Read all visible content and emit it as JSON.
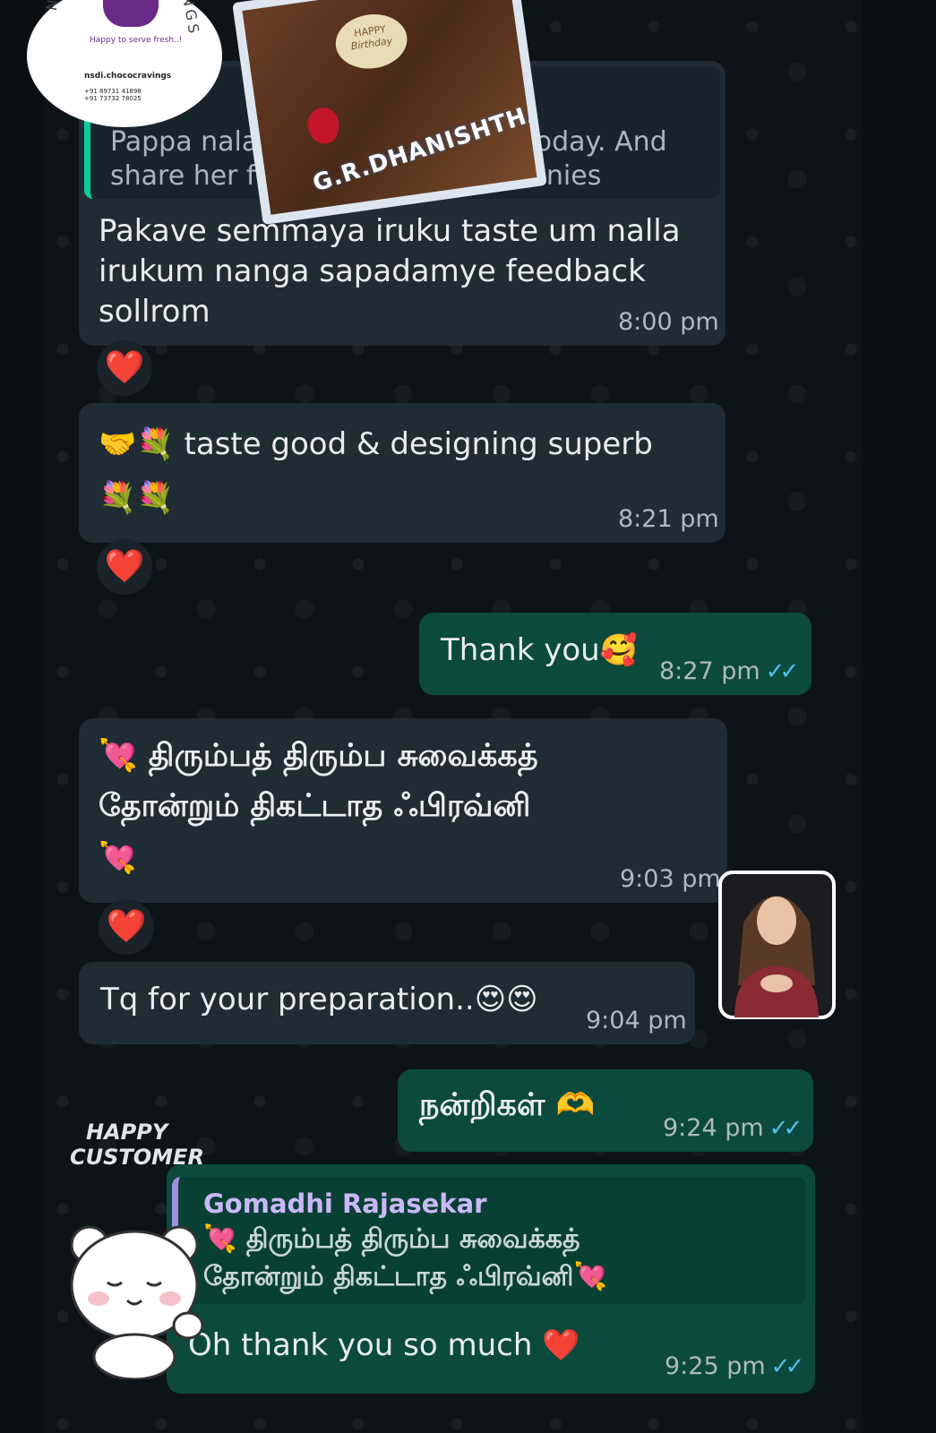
{
  "chat": {
    "logo": {
      "ring_left": "NSDI",
      "ring_right": "INGS",
      "tagline": "Happy to serve fresh..!",
      "instagram": "nsdi.chococravings",
      "phone_1": "+91 89731 41898",
      "phone_2": "+91 73732 78025"
    },
    "cake_photo": {
      "plaque_line1": "HAPPY",
      "plaque_line2": "Birthday",
      "name_on_cake": "G.R.DHANISHTHA"
    },
    "messages": [
      {
        "quoted_text": "Pappa nala er",
        "quoted_text_right": "today. And",
        "quoted_line2": "share her feed",
        "quoted_line2_right": "ut brownies",
        "text": "Pakave semmaya iruku taste um nalla irukum nanga sapadamye feedback sollrom",
        "time": "8:00 pm",
        "reaction": "❤️"
      },
      {
        "emoji_prefix": "🤝💐",
        "text": "taste good & designing superb",
        "emoji_suffix": "💐💐",
        "time": "8:21 pm",
        "reaction": "❤️"
      },
      {
        "text": "Thank you",
        "emoji_suffix": "🥰",
        "time": "8:27 pm"
      },
      {
        "emoji_prefix": "💘",
        "text_line1": "திரும்பத் திரும்ப சுவைக்கத்",
        "text_line2": "தோன்றும் திகட்டாத ஃபிரவ்னி",
        "emoji_suffix": "💘",
        "time": "9:03 pm",
        "reaction": "❤️"
      },
      {
        "text": "Tq for your preparation..",
        "emoji_suffix": "😍😍",
        "time": "9:04 pm"
      },
      {
        "text": "நன்றிகள்",
        "emoji_suffix": "🫶",
        "time": "9:24 pm"
      },
      {
        "quoted_author": "Gomadhi Rajasekar",
        "quoted_emoji": "💘",
        "quoted_line1": "திரும்பத் திரும்ப சுவைக்கத்",
        "quoted_line2": "தோன்றும் திகட்டாத ஃபிரவ்னி",
        "quoted_emoji_end": "💘",
        "text": "Oh thank you so much",
        "emoji_suffix": "❤️",
        "time": "9:25 pm"
      }
    ],
    "sticker_text": {
      "line1": "HAPPY",
      "line2": "CUSTOMER"
    },
    "read_tick": "✓✓",
    "colors": {
      "incoming_bubble": "#1f2c33",
      "outgoing_bubble": "#0b4a3c",
      "read_tick": "#53bdeb",
      "background": "#0d1418"
    }
  }
}
